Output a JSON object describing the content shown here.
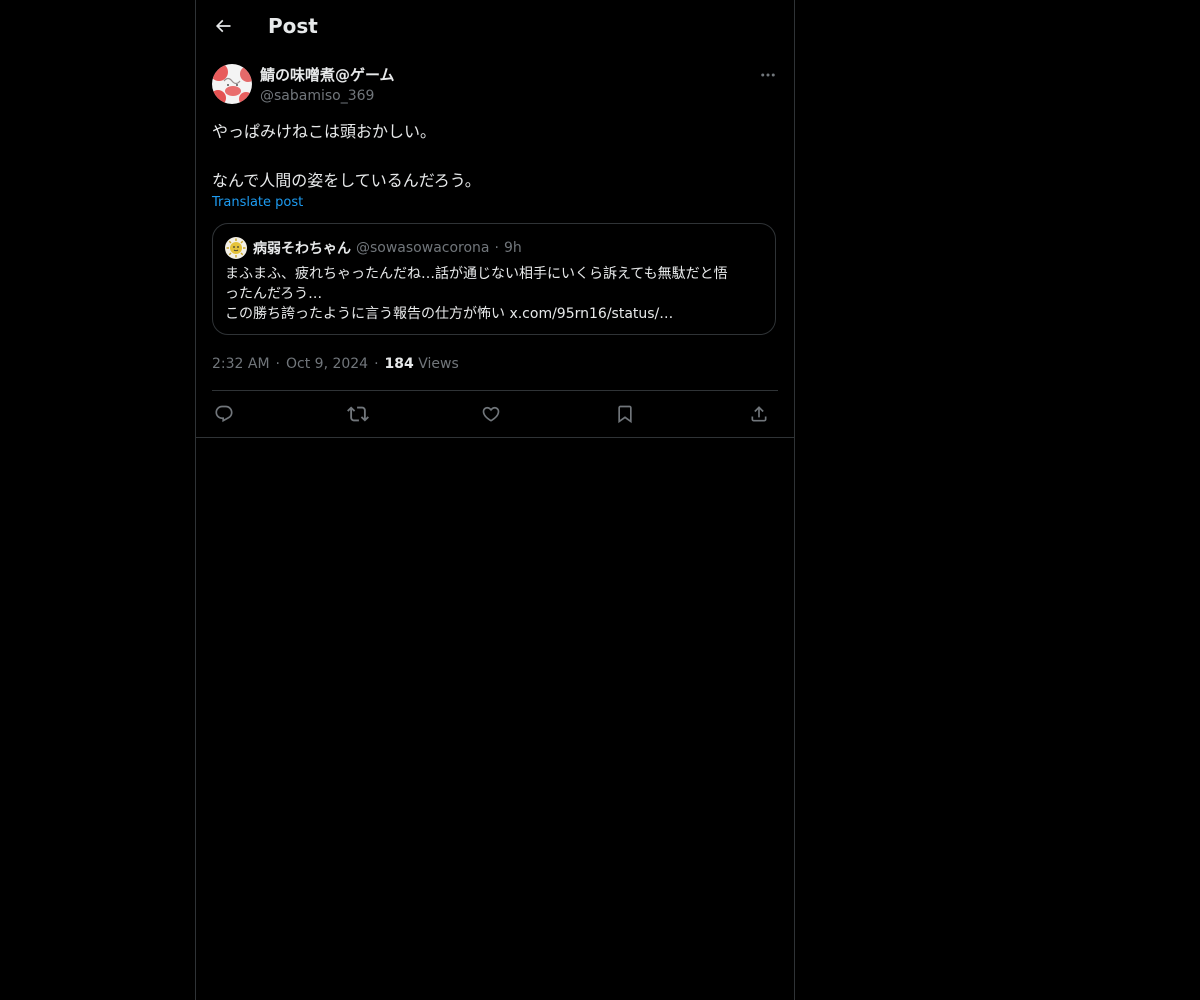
{
  "header": {
    "back_icon": "arrow-left-icon",
    "title": "Post"
  },
  "post": {
    "author": {
      "display_name": "鯖の味噌煮@ゲーム",
      "handle": "@sabamiso_369",
      "avatar_icon": "avatar-image"
    },
    "more_icon": "more-horizontal-icon",
    "text_lines": [
      "やっぱみけねこは頭おかしい。",
      "",
      "なんで人間の姿をしているんだろう。"
    ],
    "translate_label": "Translate post",
    "quote": {
      "display_name": "病弱そわちゃん",
      "handle": "@sowasowacorona",
      "separator": "·",
      "time": "9h",
      "text_lines": [
        "まふまふ、疲れちゃったんだね…話が通じない相手にいくら訴えても無駄だと悟",
        "ったんだろう…",
        "この勝ち誇ったように言う報告の仕方が怖い x.com/95rn16/status/…"
      ]
    },
    "meta": {
      "time": "2:32 AM",
      "separator": "·",
      "date": "Oct 9, 2024",
      "views_count": "184",
      "views_label": "Views"
    },
    "actions": [
      {
        "name": "reply",
        "icon": "reply-icon"
      },
      {
        "name": "repost",
        "icon": "repost-icon"
      },
      {
        "name": "like",
        "icon": "heart-icon"
      },
      {
        "name": "bookmark",
        "icon": "bookmark-icon"
      },
      {
        "name": "share",
        "icon": "share-icon"
      }
    ]
  },
  "colors": {
    "background": "#000000",
    "text": "#e7e9ea",
    "secondary_text": "#71767b",
    "link": "#1d9bf0",
    "border": "#2f3336"
  }
}
